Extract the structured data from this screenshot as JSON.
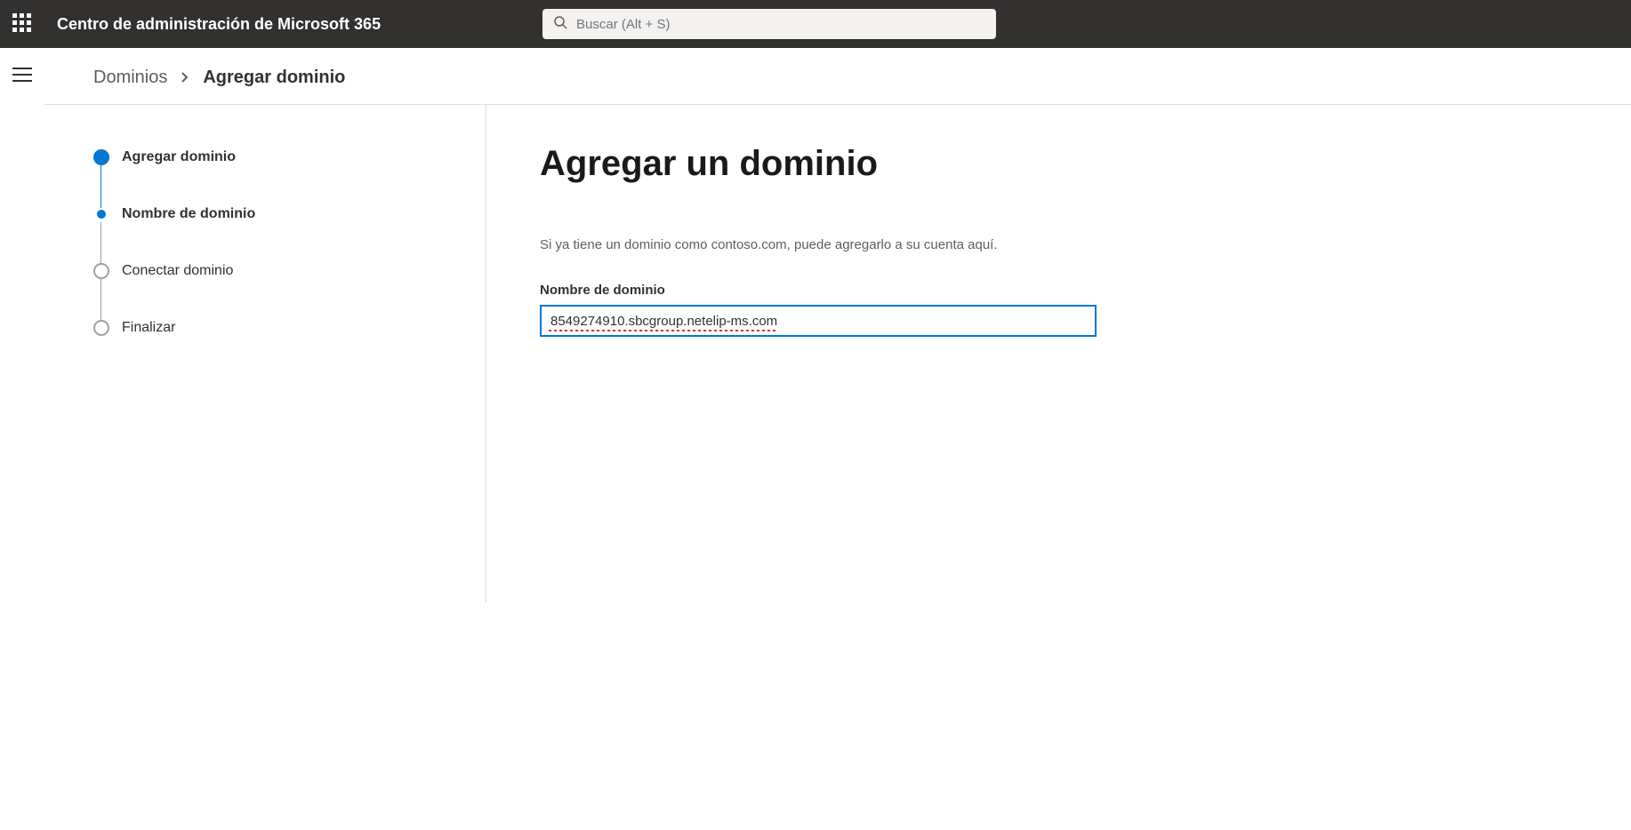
{
  "header": {
    "app_title": "Centro de administración de Microsoft 365",
    "search_placeholder": "Buscar (Alt + S)"
  },
  "breadcrumb": {
    "parent": "Dominios",
    "current": "Agregar dominio"
  },
  "stepper": {
    "steps": [
      {
        "label": "Agregar dominio",
        "state": "done"
      },
      {
        "label": "Nombre de dominio",
        "state": "active"
      },
      {
        "label": "Conectar dominio",
        "state": "pending"
      },
      {
        "label": "Finalizar",
        "state": "pending"
      }
    ]
  },
  "main": {
    "title": "Agregar un dominio",
    "help_text": "Si ya tiene un dominio como contoso.com, puede agregarlo a su cuenta aquí.",
    "field_label": "Nombre de dominio",
    "domain_value": "8549274910.sbcgroup.netelip-ms.com"
  }
}
